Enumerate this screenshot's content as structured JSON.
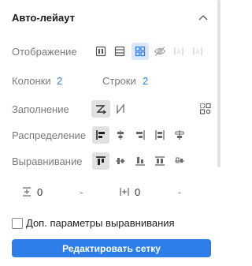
{
  "section": {
    "title": "Авто-лейаут",
    "collapse_icon": "chevron-up-icon"
  },
  "display": {
    "label": "Отображение",
    "options": [
      "columns-layout-icon",
      "rows-layout-icon",
      "grid-layout-icon",
      "hide-icon",
      "text-disabled-icon",
      "text-disabled-icon"
    ],
    "selected": "grid-layout-icon"
  },
  "grid": {
    "columns_label": "Колонки",
    "columns_value": "2",
    "rows_label": "Строки",
    "rows_value": "2"
  },
  "fill": {
    "label": "Заполнение",
    "options": [
      "fill-z-icon",
      "fill-n-icon"
    ],
    "selected": "fill-z-icon",
    "extra_icon": "grid-settings-icon"
  },
  "distribution": {
    "label": "Распределение",
    "options": [
      "align-left-icon",
      "align-center-icon",
      "align-right-icon",
      "space-between-icon",
      "space-around-icon"
    ],
    "selected": "align-left-icon"
  },
  "alignment": {
    "label": "Выравнивание",
    "options": [
      "align-top-icon",
      "align-middle-icon",
      "align-bottom-icon",
      "stretch-icon",
      "baseline-icon"
    ],
    "selected": "align-top-icon"
  },
  "gaps": {
    "vertical_gap_value": "0",
    "vertical_gap_dash": "-",
    "horizontal_gap_value": "0",
    "horizontal_gap_dash": "-"
  },
  "options": {
    "checkbox_label": "Доп. параметры выравнивания",
    "checked": false
  },
  "actions": {
    "edit_grid_label": "Редактировать сетку"
  },
  "colors": {
    "accent": "#2d7ee8",
    "selected_bg": "#e1e1e1",
    "selected_blue_bg": "#dbe8fb"
  }
}
